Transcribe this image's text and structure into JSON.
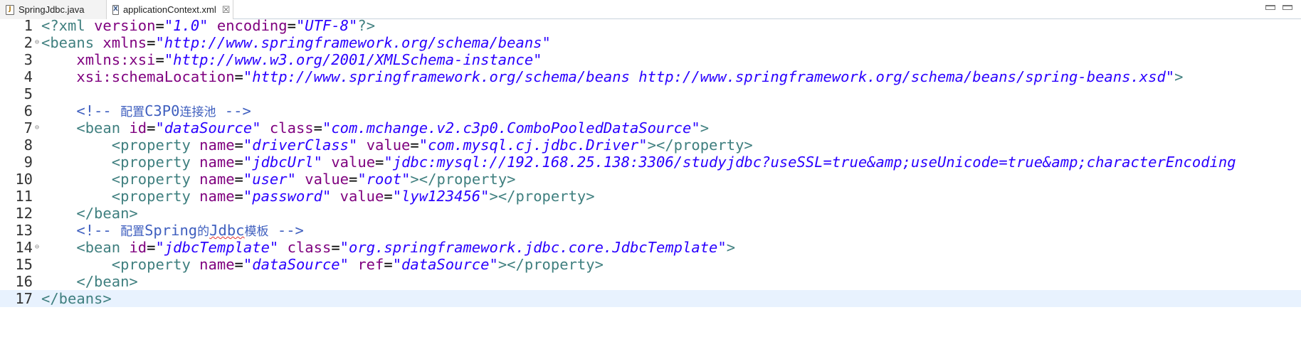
{
  "tabs": [
    {
      "label": "SpringJdbc.java",
      "icon": "java-file-icon",
      "active": false
    },
    {
      "label": "applicationContext.xml",
      "icon": "xml-file-icon",
      "active": true,
      "close": "☒"
    }
  ],
  "editor": {
    "current_line": 17,
    "lines": [
      {
        "n": "1",
        "fold": "",
        "tokens": [
          {
            "c": "t-tag",
            "t": "<?xml "
          },
          {
            "c": "t-attr",
            "t": "version"
          },
          {
            "c": "t-eq",
            "t": "="
          },
          {
            "c": "t-val",
            "t": "\"1.0\""
          },
          {
            "c": "t-eq",
            "t": " "
          },
          {
            "c": "t-attr",
            "t": "encoding"
          },
          {
            "c": "t-eq",
            "t": "="
          },
          {
            "c": "t-val",
            "t": "\"UTF-8\""
          },
          {
            "c": "t-tag",
            "t": "?>"
          }
        ]
      },
      {
        "n": "2",
        "fold": "⊖",
        "tokens": [
          {
            "c": "t-tag",
            "t": "<beans "
          },
          {
            "c": "t-attr",
            "t": "xmlns"
          },
          {
            "c": "t-eq",
            "t": "="
          },
          {
            "c": "t-val",
            "t": "\"http://www.springframework.org/schema/beans\""
          }
        ]
      },
      {
        "n": "3",
        "fold": "",
        "tokens": [
          {
            "c": "t-eq",
            "t": "    "
          },
          {
            "c": "t-attr",
            "t": "xmlns:xsi"
          },
          {
            "c": "t-eq",
            "t": "="
          },
          {
            "c": "t-val",
            "t": "\"http://www.w3.org/2001/XMLSchema-instance\""
          }
        ]
      },
      {
        "n": "4",
        "fold": "",
        "tokens": [
          {
            "c": "t-eq",
            "t": "    "
          },
          {
            "c": "t-attr",
            "t": "xsi:schemaLocation"
          },
          {
            "c": "t-eq",
            "t": "="
          },
          {
            "c": "t-val",
            "t": "\"http://www.springframework.org/schema/beans http://www.springframework.org/schema/beans/spring-beans.xsd\""
          },
          {
            "c": "t-tag",
            "t": ">"
          }
        ]
      },
      {
        "n": "5",
        "fold": "",
        "tokens": []
      },
      {
        "n": "6",
        "fold": "",
        "tokens": [
          {
            "c": "t-eq",
            "t": "    "
          },
          {
            "c": "t-com",
            "t": "<!-- "
          },
          {
            "c": "t-com t-cjk",
            "t": "配置"
          },
          {
            "c": "t-com",
            "t": "C3P0"
          },
          {
            "c": "t-com t-cjk",
            "t": "连接池"
          },
          {
            "c": "t-com",
            "t": " -->"
          }
        ]
      },
      {
        "n": "7",
        "fold": "⊖",
        "tokens": [
          {
            "c": "t-eq",
            "t": "    "
          },
          {
            "c": "t-tag",
            "t": "<bean "
          },
          {
            "c": "t-attr",
            "t": "id"
          },
          {
            "c": "t-eq",
            "t": "="
          },
          {
            "c": "t-val",
            "t": "\"dataSource\""
          },
          {
            "c": "t-eq",
            "t": " "
          },
          {
            "c": "t-attr",
            "t": "class"
          },
          {
            "c": "t-eq",
            "t": "="
          },
          {
            "c": "t-val",
            "t": "\"com.mchange.v2.c3p0.ComboPooledDataSource\""
          },
          {
            "c": "t-tag",
            "t": ">"
          }
        ]
      },
      {
        "n": "8",
        "fold": "",
        "tokens": [
          {
            "c": "t-eq",
            "t": "        "
          },
          {
            "c": "t-tag",
            "t": "<property "
          },
          {
            "c": "t-attr",
            "t": "name"
          },
          {
            "c": "t-eq",
            "t": "="
          },
          {
            "c": "t-val",
            "t": "\"driverClass\""
          },
          {
            "c": "t-eq",
            "t": " "
          },
          {
            "c": "t-attr",
            "t": "value"
          },
          {
            "c": "t-eq",
            "t": "="
          },
          {
            "c": "t-val",
            "t": "\"com.mysql.cj.jdbc.Driver\""
          },
          {
            "c": "t-tag",
            "t": "></property>"
          }
        ]
      },
      {
        "n": "9",
        "fold": "",
        "tokens": [
          {
            "c": "t-eq",
            "t": "        "
          },
          {
            "c": "t-tag",
            "t": "<property "
          },
          {
            "c": "t-attr",
            "t": "name"
          },
          {
            "c": "t-eq",
            "t": "="
          },
          {
            "c": "t-val",
            "t": "\"jdbcUrl\""
          },
          {
            "c": "t-eq",
            "t": " "
          },
          {
            "c": "t-attr",
            "t": "value"
          },
          {
            "c": "t-eq",
            "t": "="
          },
          {
            "c": "t-val",
            "t": "\"jdbc:mysql://192.168.25.138:3306/studyjdbc?useSSL=true&amp;useUnicode=true&amp;characterEncoding"
          }
        ]
      },
      {
        "n": "10",
        "fold": "",
        "tokens": [
          {
            "c": "t-eq",
            "t": "        "
          },
          {
            "c": "t-tag",
            "t": "<property "
          },
          {
            "c": "t-attr",
            "t": "name"
          },
          {
            "c": "t-eq",
            "t": "="
          },
          {
            "c": "t-val",
            "t": "\"user\""
          },
          {
            "c": "t-eq",
            "t": " "
          },
          {
            "c": "t-attr",
            "t": "value"
          },
          {
            "c": "t-eq",
            "t": "="
          },
          {
            "c": "t-val",
            "t": "\"root\""
          },
          {
            "c": "t-tag",
            "t": "></property>"
          }
        ]
      },
      {
        "n": "11",
        "fold": "",
        "tokens": [
          {
            "c": "t-eq",
            "t": "        "
          },
          {
            "c": "t-tag",
            "t": "<property "
          },
          {
            "c": "t-attr",
            "t": "name"
          },
          {
            "c": "t-eq",
            "t": "="
          },
          {
            "c": "t-val",
            "t": "\"password\""
          },
          {
            "c": "t-eq",
            "t": " "
          },
          {
            "c": "t-attr",
            "t": "value"
          },
          {
            "c": "t-eq",
            "t": "="
          },
          {
            "c": "t-val",
            "t": "\"lyw123456\""
          },
          {
            "c": "t-tag",
            "t": "></property>"
          }
        ]
      },
      {
        "n": "12",
        "fold": "",
        "tokens": [
          {
            "c": "t-eq",
            "t": "    "
          },
          {
            "c": "t-tag",
            "t": "</bean>"
          }
        ]
      },
      {
        "n": "13",
        "fold": "",
        "tokens": [
          {
            "c": "t-eq",
            "t": "    "
          },
          {
            "c": "t-com",
            "t": "<!-- "
          },
          {
            "c": "t-com t-cjk",
            "t": "配置"
          },
          {
            "c": "t-com",
            "t": "Spring"
          },
          {
            "c": "t-com t-cjk",
            "t": "的"
          },
          {
            "c": "t-com squiggle",
            "t": "Jdbc"
          },
          {
            "c": "t-com t-cjk",
            "t": "模板"
          },
          {
            "c": "t-com",
            "t": " -->"
          }
        ]
      },
      {
        "n": "14",
        "fold": "⊖",
        "tokens": [
          {
            "c": "t-eq",
            "t": "    "
          },
          {
            "c": "t-tag",
            "t": "<bean "
          },
          {
            "c": "t-attr",
            "t": "id"
          },
          {
            "c": "t-eq",
            "t": "="
          },
          {
            "c": "t-val",
            "t": "\"jdbcTemplate\""
          },
          {
            "c": "t-eq",
            "t": " "
          },
          {
            "c": "t-attr",
            "t": "class"
          },
          {
            "c": "t-eq",
            "t": "="
          },
          {
            "c": "t-val",
            "t": "\"org.springframework.jdbc.core.JdbcTemplate\""
          },
          {
            "c": "t-tag",
            "t": ">"
          }
        ]
      },
      {
        "n": "15",
        "fold": "",
        "tokens": [
          {
            "c": "t-eq",
            "t": "        "
          },
          {
            "c": "t-tag",
            "t": "<property "
          },
          {
            "c": "t-attr",
            "t": "name"
          },
          {
            "c": "t-eq",
            "t": "="
          },
          {
            "c": "t-val",
            "t": "\"dataSource\""
          },
          {
            "c": "t-eq",
            "t": " "
          },
          {
            "c": "t-attr",
            "t": "ref"
          },
          {
            "c": "t-eq",
            "t": "="
          },
          {
            "c": "t-val",
            "t": "\"dataSource\""
          },
          {
            "c": "t-tag",
            "t": "></property>"
          }
        ]
      },
      {
        "n": "16",
        "fold": "",
        "tokens": [
          {
            "c": "t-eq",
            "t": "    "
          },
          {
            "c": "t-tag",
            "t": "</bean>"
          }
        ]
      },
      {
        "n": "17",
        "fold": "",
        "tokens": [
          {
            "c": "t-tag",
            "t": "</beans>"
          }
        ]
      }
    ]
  }
}
